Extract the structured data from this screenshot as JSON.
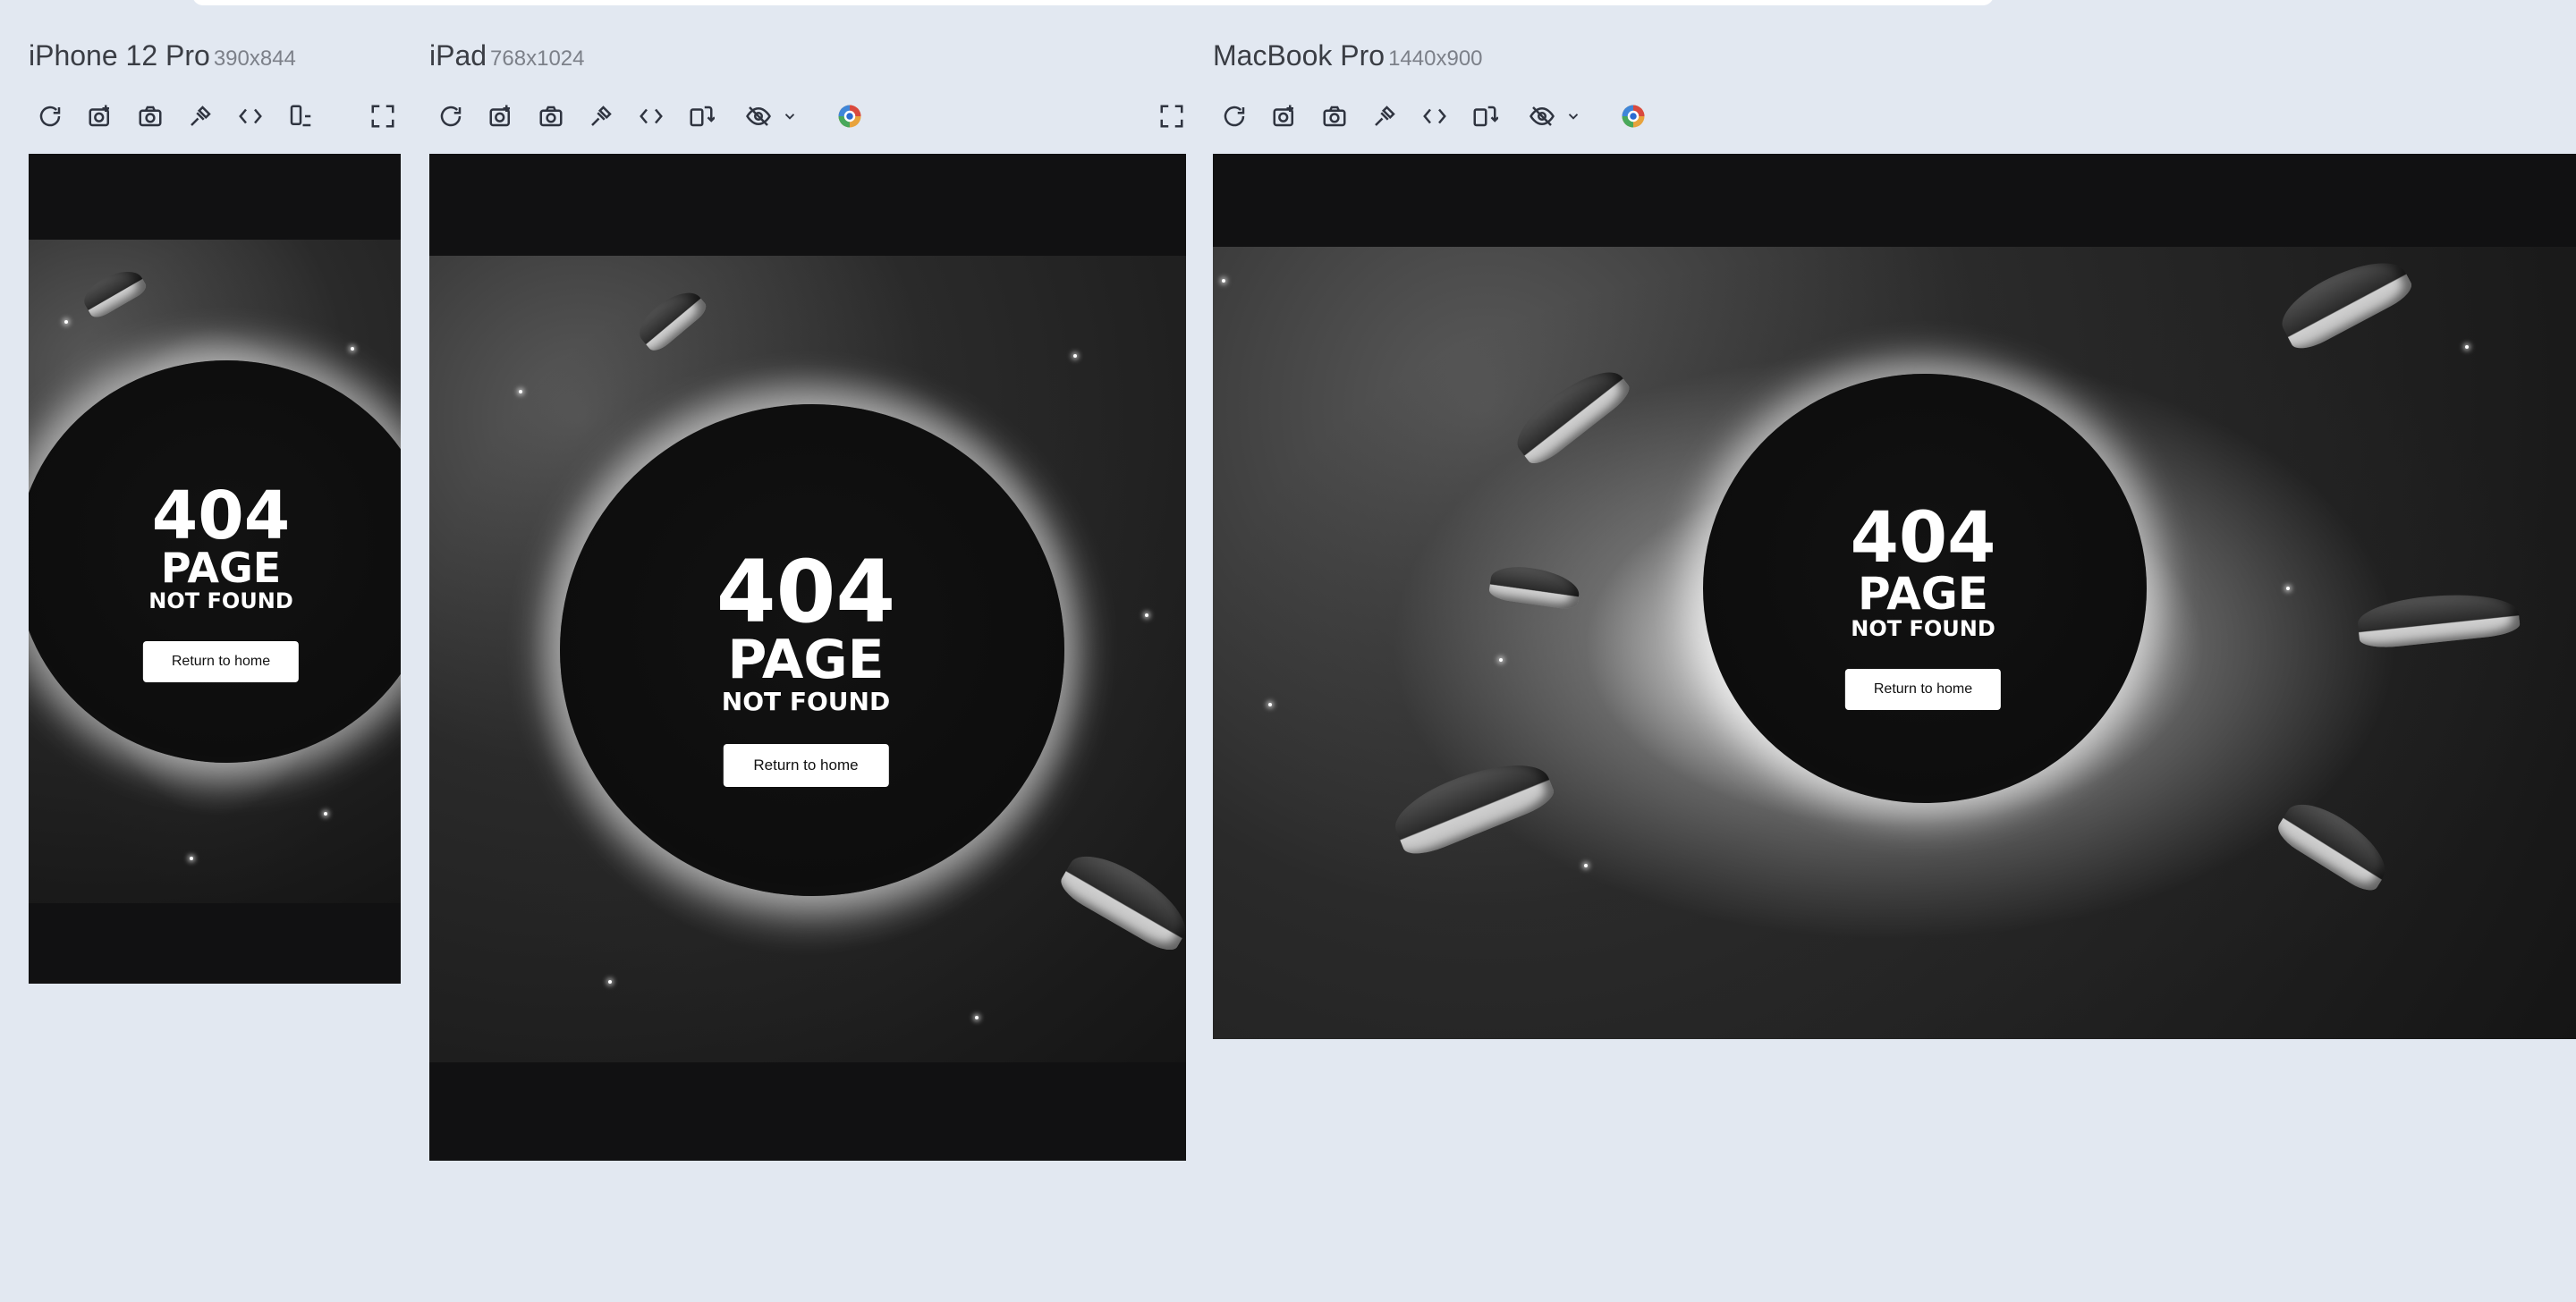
{
  "devices": [
    {
      "name": "iPhone 12 Pro",
      "size": "390x844",
      "page": {
        "code": "404",
        "title": "PAGE",
        "subtitle": "NOT FOUND",
        "button_label": "Return to home"
      }
    },
    {
      "name": "iPad",
      "size": "768x1024",
      "page": {
        "code": "404",
        "title": "PAGE",
        "subtitle": "NOT FOUND",
        "button_label": "Return to home"
      }
    },
    {
      "name": "MacBook Pro",
      "size": "1440x900",
      "page": {
        "code": "404",
        "title": "PAGE",
        "subtitle": "NOT FOUND",
        "button_label": "Return to home"
      }
    }
  ],
  "toolbar_icons": [
    "refresh-icon",
    "screenshot-full-icon",
    "camera-icon",
    "pick-element-icon",
    "code-icon",
    "rotate-device-icon",
    "hide-icon",
    "chevron-down-icon",
    "color-picker-icon",
    "fullscreen-icon"
  ],
  "colors": {
    "background": "#e2e8f1",
    "page_bg": "#111112",
    "button_bg": "#ffffff"
  }
}
